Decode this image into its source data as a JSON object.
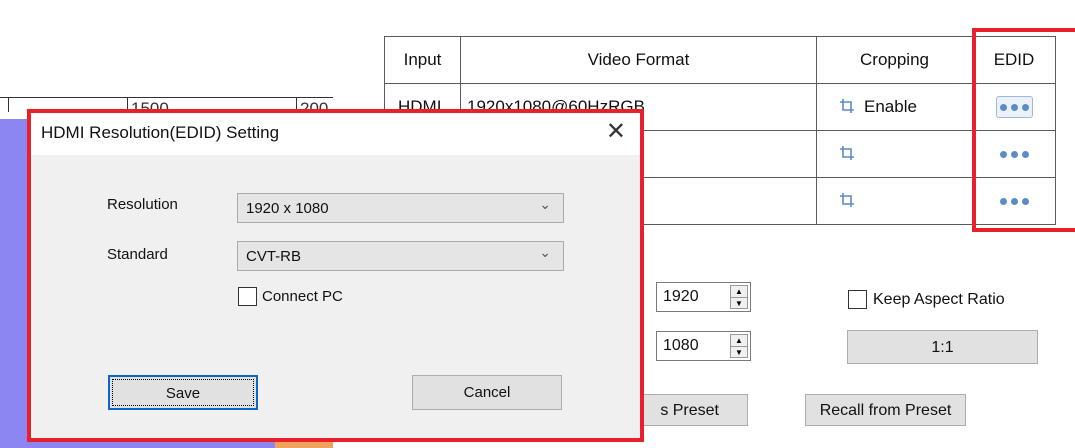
{
  "ruler": {
    "labels": [
      "1500",
      "200"
    ]
  },
  "input_table": {
    "headers": [
      "Input",
      "Video Format",
      "Cropping",
      "EDID"
    ],
    "rows": [
      {
        "input": "HDMI",
        "format": "1920x1080@60HzRGB",
        "crop": "Enable"
      },
      {
        "input": "",
        "format": "",
        "crop": ""
      },
      {
        "input": "",
        "format": "",
        "crop": ""
      }
    ]
  },
  "output": {
    "width_value": "1920",
    "height_value": "1080",
    "keep_aspect_label": "Keep Aspect Ratio",
    "ratio_button": "1:1",
    "save_preset_button": "s Preset",
    "recall_preset_button": "Recall from Preset"
  },
  "dialog": {
    "title": "HDMI Resolution(EDID) Setting",
    "close_glyph": "✕",
    "resolution_label": "Resolution",
    "resolution_value": "1920 x 1080",
    "standard_label": "Standard",
    "standard_value": "CVT-RB",
    "connect_pc_label": "Connect PC",
    "save_button": "Save",
    "cancel_button": "Cancel"
  },
  "colors": {
    "highlight": "#e8202a",
    "canvas_purple": "#8b86f2",
    "canvas_orange": "#f0a35c",
    "icon_blue": "#5b8cc9"
  },
  "icons": {
    "crop": "crop-icon",
    "more": "more-dots-icon",
    "spin": "spin-arrows-icon",
    "dropdown": "chevron-down-icon"
  }
}
